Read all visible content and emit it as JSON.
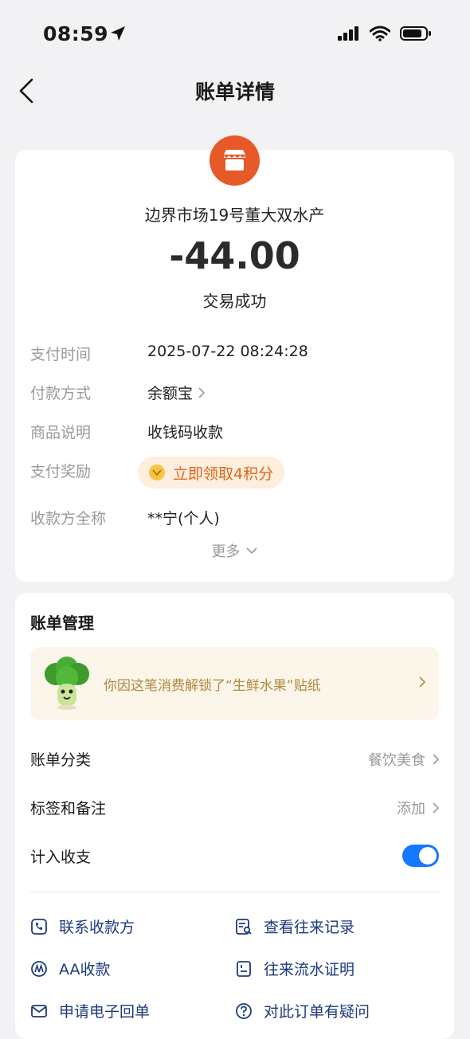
{
  "status_bar": {
    "time": "08:59"
  },
  "nav": {
    "title": "账单详情"
  },
  "bill": {
    "merchant": "边界市场19号董大双水产",
    "amount": "-44.00",
    "status": "交易成功",
    "details": [
      {
        "label": "支付时间",
        "value": "2025-07-22 08:24:28"
      },
      {
        "label": "付款方式",
        "value": "余额宝"
      },
      {
        "label": "商品说明",
        "value": "收钱码收款"
      },
      {
        "label": "支付奖励",
        "value": "立即领取4积分"
      },
      {
        "label": "收款方全称",
        "value": "**宁(个人)"
      }
    ],
    "more": "更多"
  },
  "management": {
    "title": "账单管理",
    "sticker_text": "你因这笔消费解锁了“生鲜水果”贴纸",
    "category_label": "账单分类",
    "category_value": "餐饮美食",
    "tags_label": "标签和备注",
    "tags_value": "添加",
    "include_label": "计入收支",
    "include_enabled": true,
    "actions": [
      {
        "label": "联系收款方",
        "icon": "phone-icon"
      },
      {
        "label": "查看往来记录",
        "icon": "record-search-icon"
      },
      {
        "label": "AA收款",
        "icon": "aa-icon"
      },
      {
        "label": "往来流水证明",
        "icon": "document-icon"
      },
      {
        "label": "申请电子回单",
        "icon": "mail-icon"
      },
      {
        "label": "对此订单有疑问",
        "icon": "question-icon"
      }
    ]
  },
  "colors": {
    "accent": "#1677ff",
    "merchant_logo": "#e8592a",
    "reward": "#e0661c",
    "link": "#1c3a7a"
  }
}
